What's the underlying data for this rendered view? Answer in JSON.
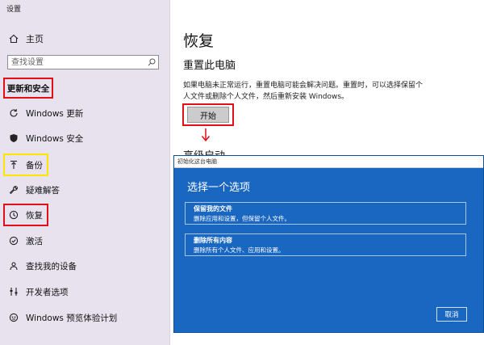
{
  "window": {
    "title": "设置"
  },
  "sidebar": {
    "home_label": "主页",
    "search_placeholder": "查找设置",
    "section_title": "更新和安全",
    "items": [
      {
        "label": "Windows 更新",
        "icon": "sync-icon"
      },
      {
        "label": "Windows 安全",
        "icon": "shield-icon"
      },
      {
        "label": "备份",
        "icon": "backup-arrow-icon"
      },
      {
        "label": "疑难解答",
        "icon": "wrench-icon"
      },
      {
        "label": "恢复",
        "icon": "history-icon"
      },
      {
        "label": "激活",
        "icon": "check-circle-icon"
      },
      {
        "label": "查找我的设备",
        "icon": "person-location-icon"
      },
      {
        "label": "开发者选项",
        "icon": "developer-icon"
      },
      {
        "label": "Windows 预览体验计划",
        "icon": "insider-icon"
      }
    ]
  },
  "main": {
    "title": "恢复",
    "reset_heading": "重置此电脑",
    "reset_desc": "如果电脑未正常运行，重置电脑可能会解决问题。重置时，可以选择保留个人文件或删除个人文件，然后重新安装 Windows。",
    "start_button": "开始",
    "partial_heading": "高级启动"
  },
  "dialog": {
    "title": "初始化这台电脑",
    "heading": "选择一个选项",
    "options": [
      {
        "title": "保留我的文件",
        "desc": "删除应用和设置，但保留个人文件。"
      },
      {
        "title": "删除所有内容",
        "desc": "删除所有个人文件、应用和设置。"
      }
    ],
    "cancel": "取消"
  },
  "colors": {
    "sidebar_bg": "#e7e2ee",
    "dialog_bg": "#1967c0",
    "highlight_red": "#e10f16",
    "highlight_yellow": "#ffe600"
  }
}
